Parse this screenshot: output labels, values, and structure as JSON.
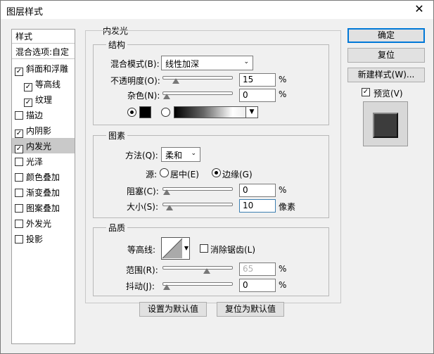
{
  "window": {
    "title": "图层样式",
    "close_glyph": "✕"
  },
  "styles": {
    "header": "样式",
    "blend_options": "混合选项:自定",
    "items": [
      {
        "label": "斜面和浮雕",
        "checked": true
      },
      {
        "label": "等高线",
        "checked": true,
        "sub": true
      },
      {
        "label": "纹理",
        "checked": true,
        "sub": true
      },
      {
        "label": "描边",
        "checked": false
      },
      {
        "label": "内阴影",
        "checked": true
      },
      {
        "label": "内发光",
        "checked": true,
        "selected": true
      },
      {
        "label": "光泽",
        "checked": false
      },
      {
        "label": "颜色叠加",
        "checked": false
      },
      {
        "label": "渐变叠加",
        "checked": false
      },
      {
        "label": "图案叠加",
        "checked": false
      },
      {
        "label": "外发光",
        "checked": false
      },
      {
        "label": "投影",
        "checked": false
      }
    ]
  },
  "panel": {
    "title": "内发光",
    "structure": {
      "title": "结构",
      "blend_mode_label": "混合模式(B):",
      "blend_mode_value": "线性加深",
      "opacity_label": "不透明度(O):",
      "opacity_value": "15",
      "opacity_pct": 0.15,
      "noise_label": "杂色(N):",
      "noise_value": "0",
      "noise_pct": 0,
      "unit": "%"
    },
    "elements": {
      "title": "图素",
      "method_label": "方法(Q):",
      "method_value": "柔和",
      "source_label": "源:",
      "source_center": "居中(E)",
      "source_edge": "边缘(G)",
      "choke_label": "阻塞(C):",
      "choke_value": "0",
      "choke_pct": 0,
      "size_label": "大小(S):",
      "size_value": "10",
      "size_pct": 0.04,
      "size_unit": "像素",
      "unit": "%"
    },
    "quality": {
      "title": "品质",
      "contour_label": "等高线:",
      "antialias_label": "消除锯齿(L)",
      "range_label": "范围(R):",
      "range_value": "65",
      "range_pct": 0.65,
      "jitter_label": "抖动(J):",
      "jitter_value": "0",
      "jitter_pct": 0,
      "unit": "%"
    },
    "make_default": "设置为默认值",
    "reset_default": "复位为默认值"
  },
  "buttons": {
    "ok": "确定",
    "reset": "复位",
    "new_style": "新建样式(W)...",
    "preview": "预览(V)"
  }
}
